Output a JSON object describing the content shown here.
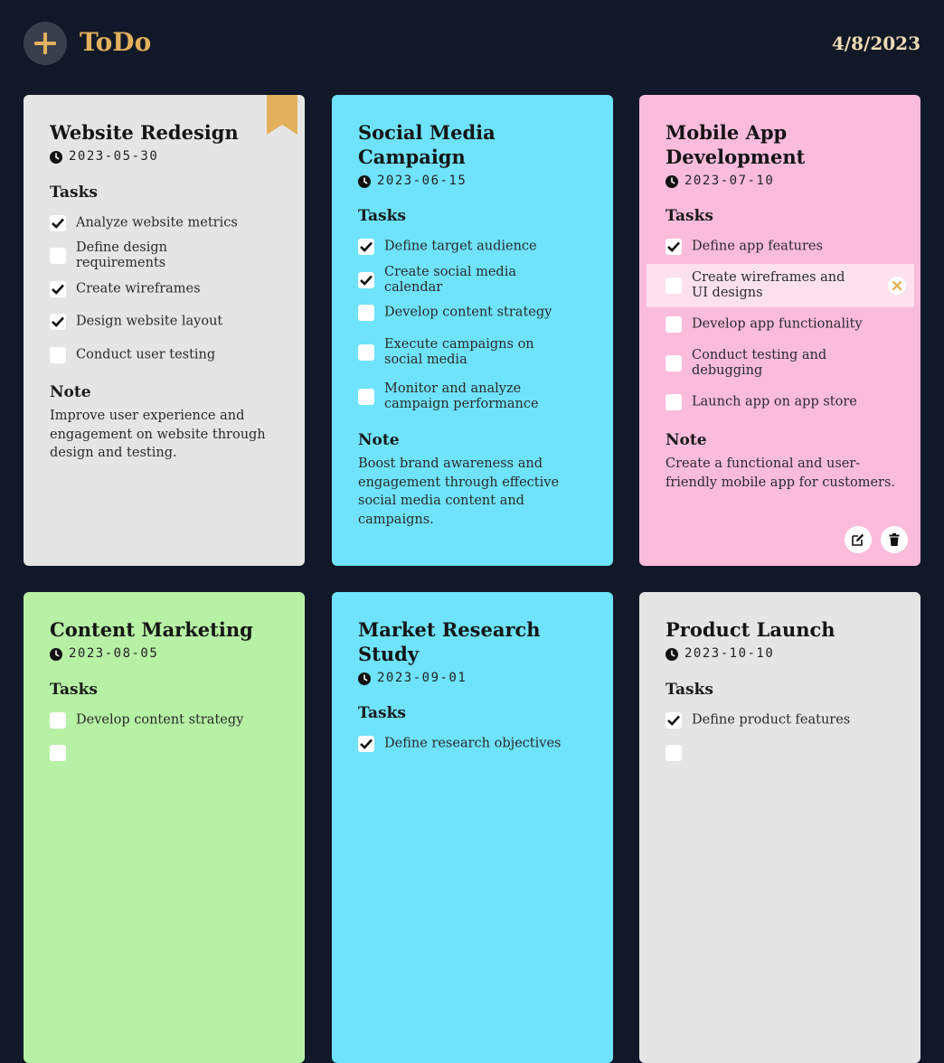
{
  "app": {
    "title": "ToDo",
    "date": "4/8/2023",
    "add_icon": "plus-icon",
    "accent": "#e3b15d",
    "background": "#111827"
  },
  "labels": {
    "tasks": "Tasks",
    "note": "Note"
  },
  "cards": [
    {
      "title": "Website Redesign",
      "date": "2023-05-30",
      "color": "#e5e5e5",
      "bookmarked": true,
      "tasks": [
        {
          "label": "Analyze website metrics",
          "done": true
        },
        {
          "label": "Define design requirements",
          "done": false
        },
        {
          "label": "Create wireframes",
          "done": true
        },
        {
          "label": "Design website layout",
          "done": true
        },
        {
          "label": "Conduct user testing",
          "done": false
        }
      ],
      "note": "Improve user experience and engagement on website through design and testing."
    },
    {
      "title": "Social Media Campaign",
      "date": "2023-06-15",
      "color": "#6ee3fb",
      "tasks": [
        {
          "label": "Define target audience",
          "done": true
        },
        {
          "label": "Create social media calendar",
          "done": true
        },
        {
          "label": "Develop content strategy",
          "done": false
        },
        {
          "label": "Execute campaigns on social media",
          "done": false
        },
        {
          "label": "Monitor and analyze campaign performance",
          "done": false
        }
      ],
      "note": "Boost brand awareness and engagement through effective social media content and campaigns."
    },
    {
      "title": "Mobile App Development",
      "date": "2023-07-10",
      "color": "#fbbcdc",
      "tasks": [
        {
          "label": "Define app features",
          "done": true
        },
        {
          "label": "Create wireframes and UI designs",
          "done": false,
          "hovered": true
        },
        {
          "label": "Develop app functionality",
          "done": false
        },
        {
          "label": "Conduct testing and debugging",
          "done": false
        },
        {
          "label": "Launch app on app store",
          "done": false
        }
      ],
      "note": "Create a functional and user-friendly mobile app for customers."
    },
    {
      "title": "Content Marketing",
      "date": "2023-08-05",
      "color": "#b7f1a5",
      "tasks": [
        {
          "label": "Develop content strategy",
          "done": false
        }
      ]
    },
    {
      "title": "Market Research Study",
      "date": "2023-09-01",
      "color": "#6ee3fb",
      "tasks": [
        {
          "label": "Define research objectives",
          "done": true
        }
      ]
    },
    {
      "title": "Product Launch",
      "date": "2023-10-10",
      "color": "#e5e5e5",
      "tasks": [
        {
          "label": "Define product features",
          "done": true
        }
      ]
    }
  ]
}
